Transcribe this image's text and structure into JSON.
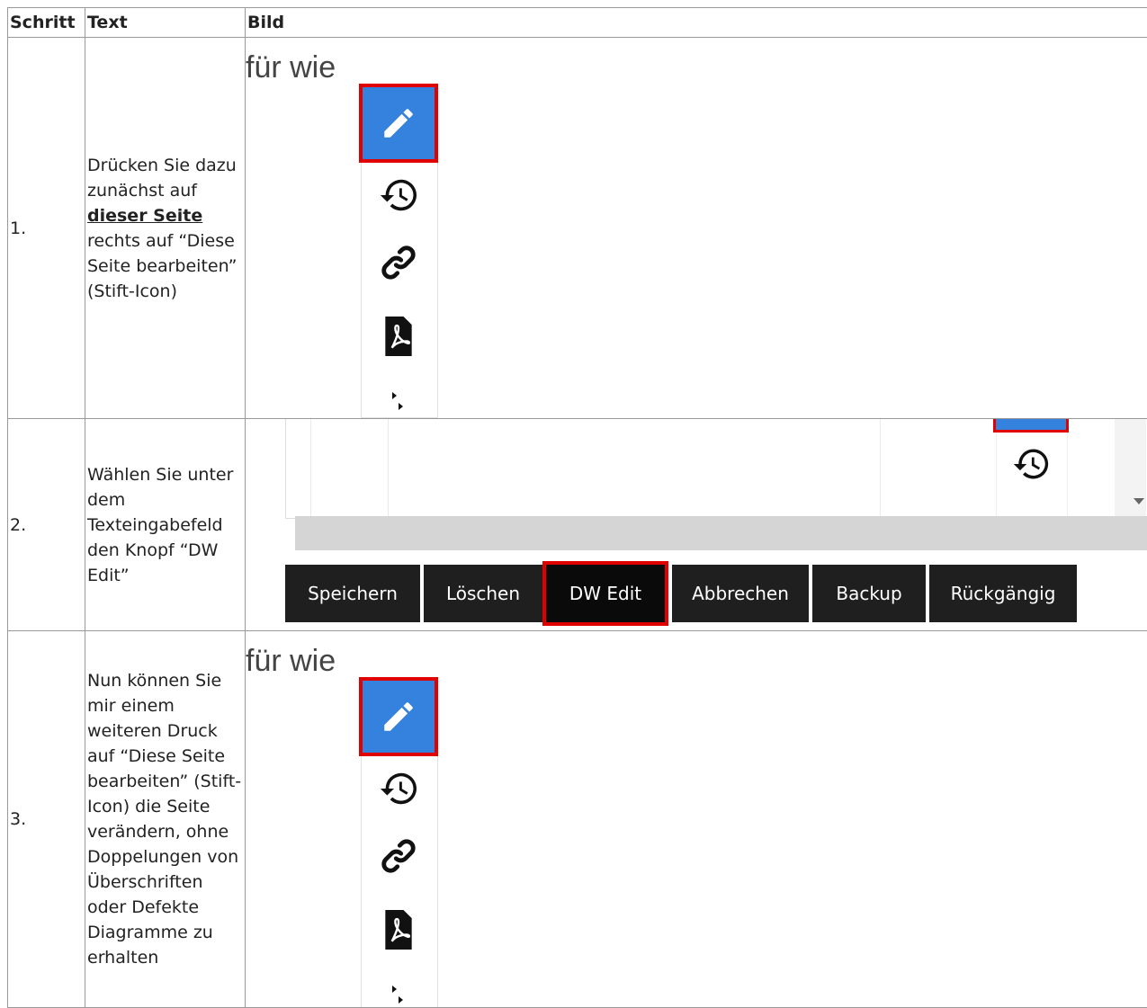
{
  "table": {
    "headers": [
      "Schritt",
      "Text",
      "Bild"
    ],
    "rows": [
      {
        "num": "1.",
        "text_pre": "Drücken Sie dazu zunächst auf ",
        "link": "dieser Seite",
        "text_post": " rechts auf “Diese Seite bearbeiten” (Stift-Icon)",
        "image": {
          "caption": "für wie"
        }
      },
      {
        "num": "2.",
        "text": "Wählen Sie unter dem Texteingabefeld den Knopf “DW Edit”",
        "image": {
          "buttons": [
            "Speichern",
            "Löschen",
            "DW Edit",
            "Abbrechen",
            "Backup",
            "Rückgängig"
          ],
          "highlighted": "DW Edit"
        }
      },
      {
        "num": "3.",
        "text": "Nun können Sie mir einem weiteren Druck auf “Diese Seite bearbeiten” (Stift-Icon) die Seite verändern, ohne Doppelungen von Überschriften oder Defekte Diagramme zu erhalten",
        "image": {
          "caption": "für wie"
        }
      }
    ]
  },
  "icons": [
    "pencil-icon",
    "history-icon",
    "link-icon",
    "pdf-icon",
    "more-icon"
  ],
  "colors": {
    "accent": "#3482dd",
    "highlight": "#e00000",
    "button": "#1f1f1f"
  }
}
